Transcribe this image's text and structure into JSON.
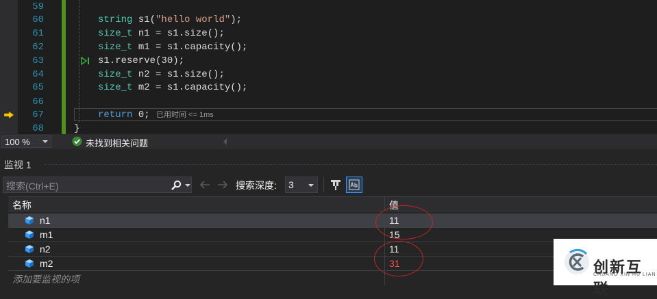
{
  "editor": {
    "lines": [
      {
        "num": "59",
        "code": ""
      },
      {
        "num": "60",
        "code": "string s1(\"hello world\");"
      },
      {
        "num": "61",
        "code": "size_t n1 = s1.size();"
      },
      {
        "num": "62",
        "code": "size_t m1 = s1.capacity();"
      },
      {
        "num": "63",
        "code": "s1.reserve(30);"
      },
      {
        "num": "64",
        "code": "size_t n2 = s1.size();"
      },
      {
        "num": "65",
        "code": "size_t m2 = s1.capacity();"
      },
      {
        "num": "66",
        "code": ""
      },
      {
        "num": "67",
        "code": "return 0;"
      },
      {
        "num": "68",
        "code": "}"
      }
    ],
    "perf_tip": "已用时间 <= 1ms",
    "current_line": "67"
  },
  "statusbar": {
    "zoom": "100 %",
    "issues": "未找到相关问题"
  },
  "watch": {
    "title": "监视 1",
    "search_placeholder": "搜索(Ctrl+E)",
    "depth_label": "搜索深度:",
    "depth_value": "3",
    "columns": {
      "name": "名称",
      "value": "值"
    },
    "rows": [
      {
        "name": "n1",
        "value": "11",
        "changed": false,
        "selected": true
      },
      {
        "name": "m1",
        "value": "15",
        "changed": false,
        "selected": false
      },
      {
        "name": "n2",
        "value": "11",
        "changed": false,
        "selected": false
      },
      {
        "name": "m2",
        "value": "31",
        "changed": true,
        "selected": false
      }
    ],
    "add_placeholder": "添加要监视的项"
  },
  "watermark": {
    "cn": "创新互联",
    "en": "CHUANG XIN HU LIAN"
  },
  "colors": {
    "accent": "#3399ff",
    "changed_value": "#f14c4c",
    "annotation": "#c0252a",
    "line_numbers": "#2b91af",
    "type": "#4ec9b0",
    "string": "#d69d85",
    "keyword": "#569cd6"
  }
}
